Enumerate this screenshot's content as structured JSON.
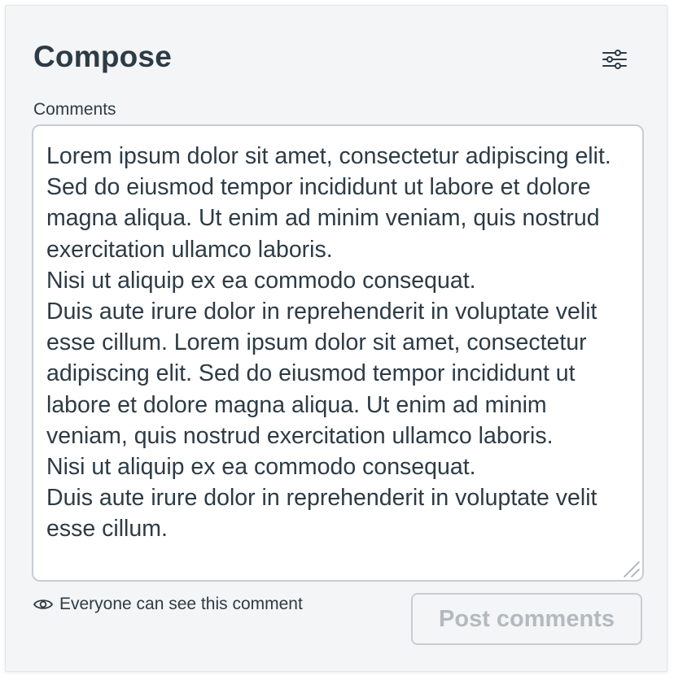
{
  "header": {
    "title": "Compose",
    "settings_icon": "sliders-icon"
  },
  "comments": {
    "label": "Comments",
    "value": "Lorem ipsum dolor sit amet, consectetur adipiscing elit. Sed do eiusmod tempor incididunt ut labore et dolore magna aliqua. Ut enim ad minim veniam, quis nostrud exercitation ullamco laboris.\nNisi ut aliquip ex ea commodo consequat.\nDuis aute irure dolor in reprehenderit in voluptate velit esse cillum. Lorem ipsum dolor sit amet, consectetur adipiscing elit. Sed do eiusmod tempor incididunt ut labore et dolore magna aliqua. Ut enim ad minim veniam, quis nostrud exercitation ullamco laboris.\nNisi ut aliquip ex ea commodo consequat.\nDuis aute irure dolor in reprehenderit in voluptate velit esse cillum."
  },
  "footer": {
    "visibility_text": "Everyone can see this comment",
    "visibility_icon": "eye-icon",
    "post_label": "Post comments",
    "post_disabled": true
  },
  "colors": {
    "panel_bg": "#f4f5f7",
    "text": "#2d3b45",
    "border": "#c7cdd1",
    "disabled_text": "#b3babf"
  }
}
